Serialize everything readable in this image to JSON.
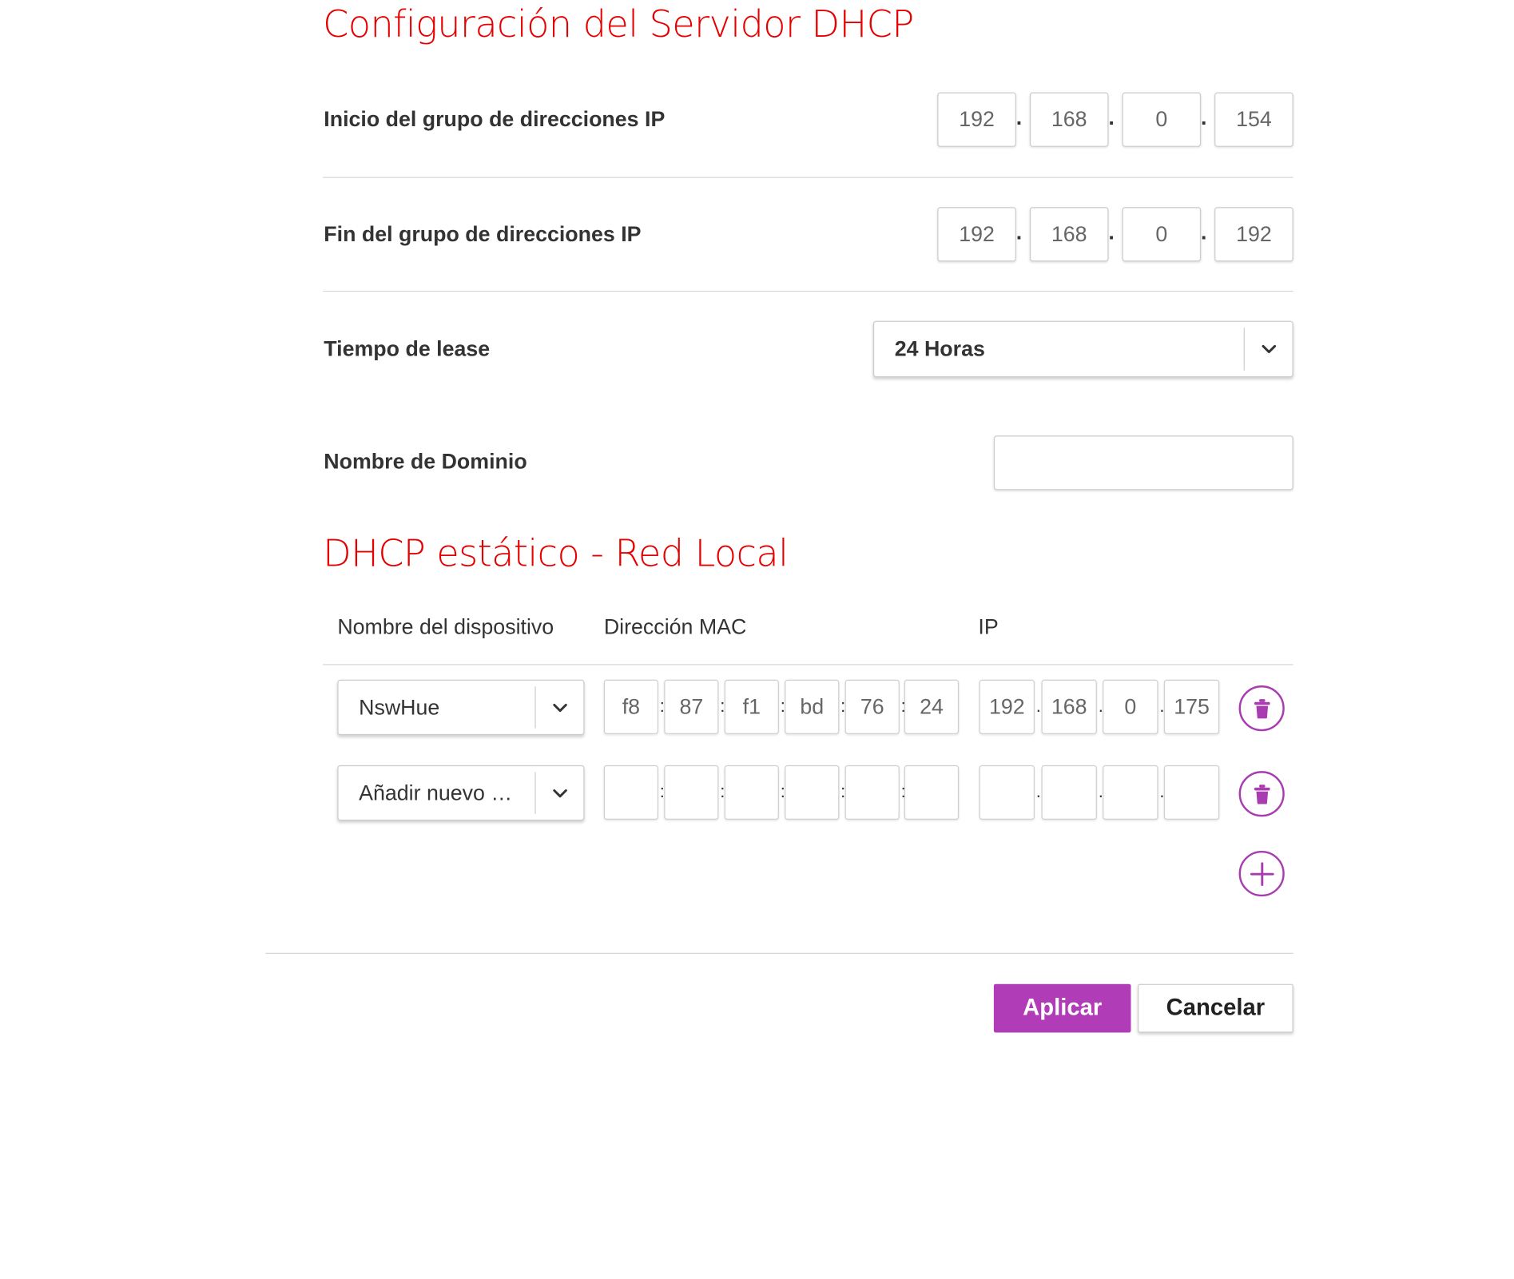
{
  "server_section": {
    "title": "Configuración del Servidor DHCP",
    "start_pool": {
      "label": "Inicio del grupo de direcciones IP",
      "octets": [
        "192",
        "168",
        "0",
        "154"
      ]
    },
    "end_pool": {
      "label": "Fin del grupo de direcciones IP",
      "octets": [
        "192",
        "168",
        "0",
        "192"
      ]
    },
    "lease": {
      "label": "Tiempo de lease",
      "selected": "24 Horas"
    },
    "domain": {
      "label": "Nombre de Dominio",
      "value": ""
    },
    "ip_separator": "."
  },
  "static_section": {
    "title": "DHCP estático - Red Local",
    "columns": {
      "device": "Nombre del dispositivo",
      "mac": "Dirección MAC",
      "ip": "IP"
    },
    "mac_separator": ":",
    "ip_separator": ".",
    "rows": [
      {
        "device": "NswHue",
        "mac": [
          "f8",
          "87",
          "f1",
          "bd",
          "76",
          "24"
        ],
        "ip": [
          "192",
          "168",
          "0",
          "175"
        ]
      },
      {
        "device": "Añadir nuevo …",
        "mac": [
          "",
          "",
          "",
          "",
          "",
          ""
        ],
        "ip": [
          "",
          "",
          "",
          ""
        ]
      }
    ]
  },
  "actions": {
    "apply": "Aplicar",
    "cancel": "Cancelar"
  },
  "icons": {
    "select_arrow": "chevron-down-icon",
    "delete": "trash-icon",
    "add": "plus-circle-icon"
  },
  "colors": {
    "title_red": "#e60000",
    "accent_purple": "#b03cb8"
  }
}
